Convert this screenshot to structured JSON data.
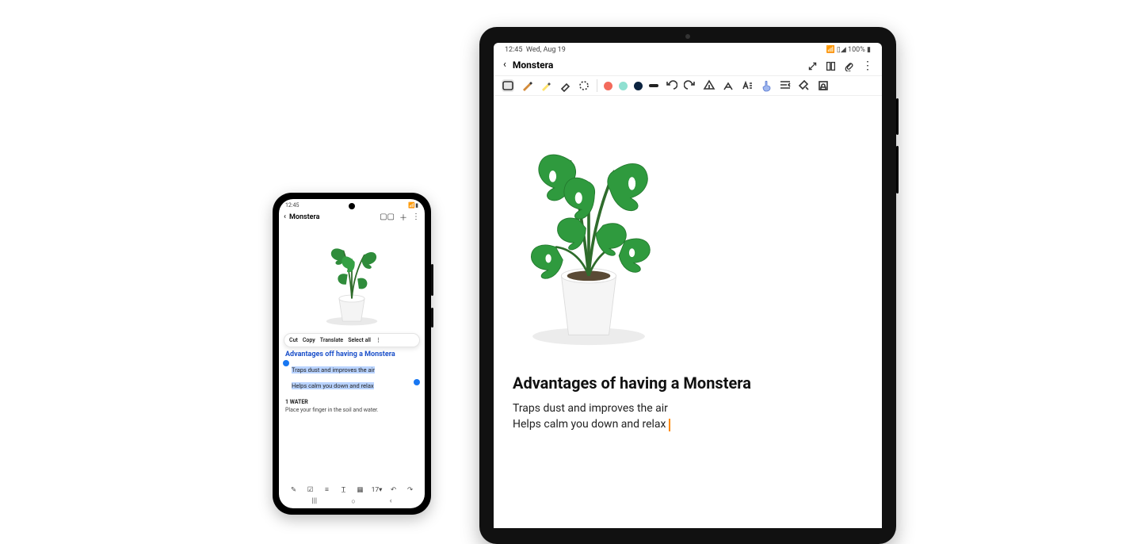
{
  "phone": {
    "status_time": "12:45",
    "title": "Monstera",
    "context_menu": [
      "Cut",
      "Copy",
      "Translate",
      "Select all"
    ],
    "headline": "Advantages off having a Monstera",
    "sel_line1": "Traps dust and improves the air",
    "sel_line2": "Helps calm you down and relax",
    "section": "1 WATER",
    "section_body": "Place your finger in the soil and water.",
    "toolbar_font": "17"
  },
  "tablet": {
    "status_time": "12:45",
    "status_date": "Wed, Aug 19",
    "status_battery": "100%",
    "title": "Monstera",
    "heading": "Advantages of having a Monstera",
    "body_line1": "Traps dust and improves the air",
    "body_line2": "Helps calm you down and relax"
  }
}
